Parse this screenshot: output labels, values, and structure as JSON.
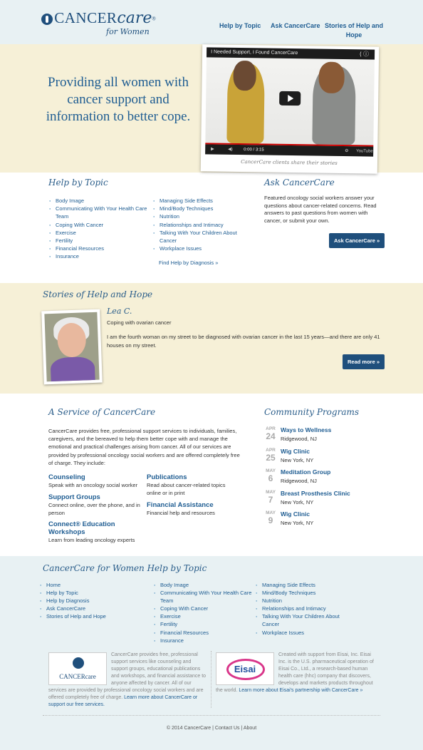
{
  "header": {
    "logo": {
      "word1": "CANCER",
      "word2": "care",
      "reg": "®",
      "sub": "for Women"
    },
    "nav": [
      {
        "label": "Help by Topic"
      },
      {
        "label": "Ask CancerCare"
      },
      {
        "label": "Stories of Help and Hope"
      }
    ]
  },
  "hero": {
    "headline": "Providing all women with cancer support and information to better cope.",
    "video": {
      "title": "I Needed Support, I Found CancerCare",
      "time": "0:00 / 3:15",
      "brand": "YouTube",
      "caption": "CancerCare clients share their stories"
    }
  },
  "help": {
    "title": "Help by Topic",
    "col1": [
      "Body Image",
      "Communicating With Your Health Care Team",
      "Coping With Cancer",
      "Exercise",
      "Fertility",
      "Financial Resources",
      "Insurance"
    ],
    "col2": [
      "Managing Side Effects",
      "Mind/Body Techniques",
      "Nutrition",
      "Relationships and Intimacy",
      "Talking With Your Children About Cancer",
      "Workplace Issues"
    ],
    "find_link": "Find Help by Diagnosis »"
  },
  "ask": {
    "title": "Ask CancerCare",
    "text": "Featured oncology social workers answer your questions about cancer-related concerns. Read answers to past questions from women with cancer, or submit your own.",
    "button": "Ask CancerCare »"
  },
  "stories": {
    "title": "Stories of Help and Hope",
    "name": "Lea C.",
    "subtitle": "Coping with ovarian cancer",
    "quote": "I am the fourth woman on my street to be diagnosed with ovarian cancer in the last 15 years—and there are only 41 houses on my street.",
    "button": "Read more »"
  },
  "service": {
    "title": "A Service of CancerCare",
    "text": "CancerCare provides free, professional support services to individuals, families, caregivers, and the bereaved to help them better cope with and manage the emotional and practical challenges arising from cancer. All of our services are provided by professional oncology social workers and are offered completely free of charge. They include:",
    "items": [
      {
        "title": "Counseling",
        "desc": "Speak with an oncology social worker"
      },
      {
        "title": "Publications",
        "desc": "Read about cancer-related topics online or in print"
      },
      {
        "title": "Support Groups",
        "desc": "Connect online, over the phone, and in person"
      },
      {
        "title": "Financial Assistance",
        "desc": "Financial help and resources"
      },
      {
        "title": "Connect® Education Workshops",
        "desc": "Learn from leading oncology experts"
      }
    ]
  },
  "community": {
    "title": "Community Programs",
    "events": [
      {
        "month": "APR",
        "day": "24",
        "title": "Ways to Wellness",
        "location": "Ridgewood, NJ"
      },
      {
        "month": "APR",
        "day": "25",
        "title": "Wig Clinic",
        "location": "New York, NY"
      },
      {
        "month": "MAY",
        "day": "6",
        "title": "Meditation Group",
        "location": "Ridgewood, NJ"
      },
      {
        "month": "MAY",
        "day": "7",
        "title": "Breast Prosthesis Clinic",
        "location": "New York, NY"
      },
      {
        "month": "MAY",
        "day": "9",
        "title": "Wig Clinic",
        "location": "New York, NY"
      }
    ]
  },
  "footer": {
    "title": "CancerCare for Women  Help by Topic",
    "col1": [
      "Home",
      "Help by Topic",
      "Help by Diagnosis",
      "Ask CancerCare",
      "Stories of Help and Hope"
    ],
    "col2": [
      "Body Image",
      "Communicating With Your Health Care Team",
      "Coping With Cancer",
      "Exercise",
      "Fertility",
      "Financial Resources",
      "Insurance"
    ],
    "col3": [
      "Managing Side Effects",
      "Mind/Body Techniques",
      "Nutrition",
      "Relationships and Intimacy",
      "Talking With Your Children About Cancer",
      "Workplace Issues"
    ],
    "cc_logo": "CANCERcare",
    "cc_text": "CancerCare provides free, professional support services like counseling and support groups, educational publications and workshops, and financial assistance to anyone affected by cancer. All of our services are provided by professional oncology social workers and are offered completely free of charge.",
    "cc_link": "Learn more about CancerCare or support our free services.",
    "eisai_logo": "Eisai",
    "eisai_text": "Created with support from Eisai, Inc. Eisai Inc. is the U.S. pharmaceutical operation of Eisai Co., Ltd., a research-based human health care (hhc) company that discovers, develops and markets products throughout the world.",
    "eisai_link": "Learn more about Eisai's partnership with CancerCare »",
    "copyright": "© 2014 CancerCare | Contact Us | About"
  },
  "colors": {
    "brand": "#1f4f7c",
    "link": "#1f5d92",
    "cream": "#f6f0d7",
    "pale_blue": "#e8f1f3"
  }
}
